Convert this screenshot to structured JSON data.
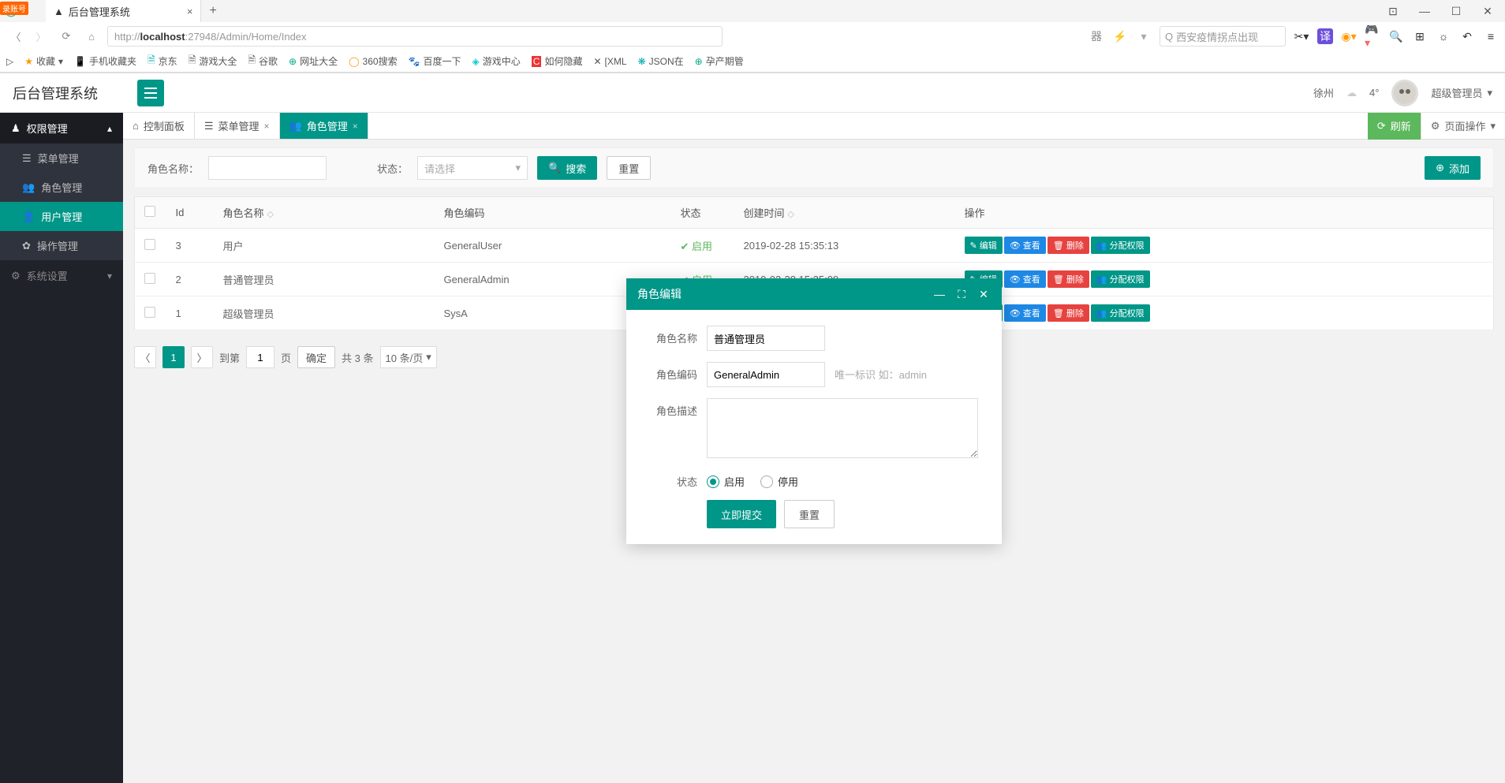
{
  "browser": {
    "tab_title": "后台管理系统",
    "url_prefix": "http://",
    "url_host": "localhost",
    "url_suffix": ":27948/Admin/Home/Index",
    "search_placeholder": "西安疫情拐点出现",
    "bookmarks": [
      "收藏",
      "手机收藏夹",
      "京东",
      "游戏大全",
      "谷歌",
      "网址大全",
      "360搜索",
      "百度一下",
      "游戏中心",
      "如何隐藏",
      "[XML",
      "JSON在",
      "孕产期管"
    ],
    "record_badge": "录账号"
  },
  "header": {
    "app_name": "后台管理系统",
    "city": "徐州",
    "weather_temp": "4°",
    "user_name": "超级管理员"
  },
  "sidebar": {
    "group1": "权限管理",
    "items1": [
      "菜单管理",
      "角色管理",
      "用户管理",
      "操作管理"
    ],
    "group2": "系统设置"
  },
  "tabs": {
    "t0": "控制面板",
    "t1": "菜单管理",
    "t2": "角色管理",
    "refresh": "刷新",
    "page_ops": "页面操作"
  },
  "filter": {
    "name_label": "角色名称：",
    "status_label": "状态：",
    "select_placeholder": "请选择",
    "search_btn": "搜索",
    "reset_btn": "重置",
    "add_btn": "添加"
  },
  "table": {
    "headers": {
      "id": "Id",
      "name": "角色名称",
      "code": "角色编码",
      "status": "状态",
      "created": "创建时间",
      "ops": "操作"
    },
    "btns": {
      "edit": "编辑",
      "view": "查看",
      "del": "删除",
      "perm": "分配权限"
    },
    "rows": [
      {
        "id": "3",
        "name": "用户",
        "code": "GeneralUser",
        "status": "启用",
        "created": "2019-02-28 15:35:13"
      },
      {
        "id": "2",
        "name": "普通管理员",
        "code": "GeneralAdmin",
        "status": "启用",
        "created": "2019-02-28 15:35:09"
      },
      {
        "id": "1",
        "name": "超级管理员",
        "code": "SysA",
        "status": "",
        "created": ""
      }
    ]
  },
  "pager": {
    "goto_label": "到第",
    "page_val": "1",
    "page_unit": "页",
    "confirm": "确定",
    "total": "共 3 条",
    "per_page": "10 条/页"
  },
  "modal": {
    "title": "角色编辑",
    "name_label": "角色名称",
    "name_val": "普通管理员",
    "code_label": "角色编码",
    "code_val": "GeneralAdmin",
    "code_hint": "唯一标识 如：admin",
    "desc_label": "角色描述",
    "status_label": "状态",
    "enable": "启用",
    "disable": "停用",
    "submit": "立即提交",
    "reset": "重置"
  }
}
